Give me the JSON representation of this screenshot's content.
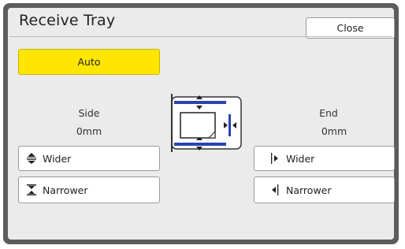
{
  "window": {
    "title": "Receive Tray"
  },
  "header": {
    "close_label": "Close"
  },
  "auto": {
    "label": "Auto",
    "color": "#ffe600",
    "active": true
  },
  "side": {
    "heading": "Side",
    "value": "0mm",
    "wider_label": "Wider",
    "wider_icon": "up-down-arrows-icon",
    "narrower_label": "Narrower",
    "narrower_icon": "arrows-inward-icon"
  },
  "end": {
    "heading": "End",
    "value": "0mm",
    "wider_label": "Wider",
    "wider_icon": "arrow-right-from-line-icon",
    "narrower_label": "Narrower",
    "narrower_icon": "arrow-left-to-line-icon"
  },
  "diagram": {
    "icon": "tray-guide-diagram-icon",
    "guide_color": "#2a43b0"
  }
}
